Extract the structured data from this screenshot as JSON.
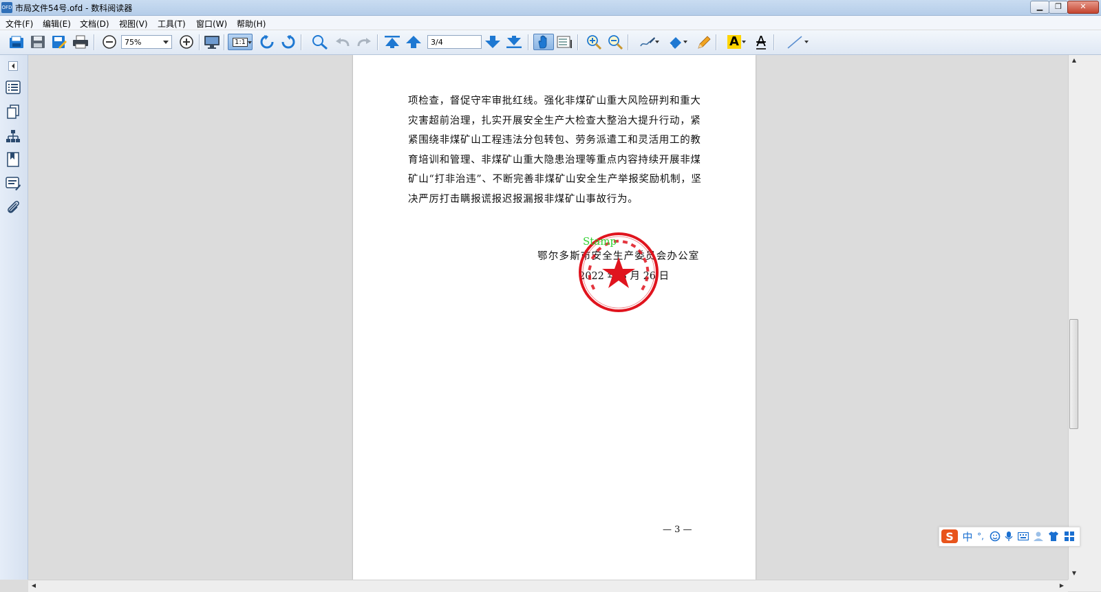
{
  "window": {
    "title": "市局文件54号.ofd - 数科阅读器",
    "app_icon_text": "OFD",
    "minimize_glyph": "▁",
    "maximize_glyph": "❐",
    "close_glyph": "✕"
  },
  "menu": {
    "file": "文件(F)",
    "edit": "编辑(E)",
    "document": "文档(D)",
    "view": "视图(V)",
    "tools": "工具(T)",
    "window": "窗口(W)",
    "help": "帮助(H)"
  },
  "toolbar": {
    "zoom_value": "75%",
    "actual_size_label": "1:1",
    "page_value": "3/4",
    "highlight_label": "A",
    "strike_label": "A"
  },
  "document": {
    "paragraph_lines": [
      "项检查，督促守牢审批红线。强化非煤矿山重大风险研判和重大",
      "灾害超前治理，扎实开展安全生产大检查大整治大提升行动，紧",
      "紧围绕非煤矿山工程违法分包转包、劳务派遣工和灵活用工的教",
      "育培训和管理、非煤矿山重大隐患治理等重点内容持续开展非煤",
      "矿山“打非治违”、不断完善非煤矿山安全生产举报奖励机制，坚",
      "决严厉打击瞒报谎报迟报漏报非煤矿山事故行为。"
    ],
    "stamp_label": "Stamp",
    "signature_org": "鄂尔多斯市安全生产委员会办公室",
    "signature_date": "2022 年 8 月 26 日",
    "page_number": "— 3 —"
  },
  "ime": {
    "logo": "S",
    "mode": "中",
    "punct": "°,"
  },
  "colors": {
    "stamp_red": "#e0141e",
    "stamp_label_green": "#32d232",
    "toolbar_blue": "#1e78d2"
  }
}
